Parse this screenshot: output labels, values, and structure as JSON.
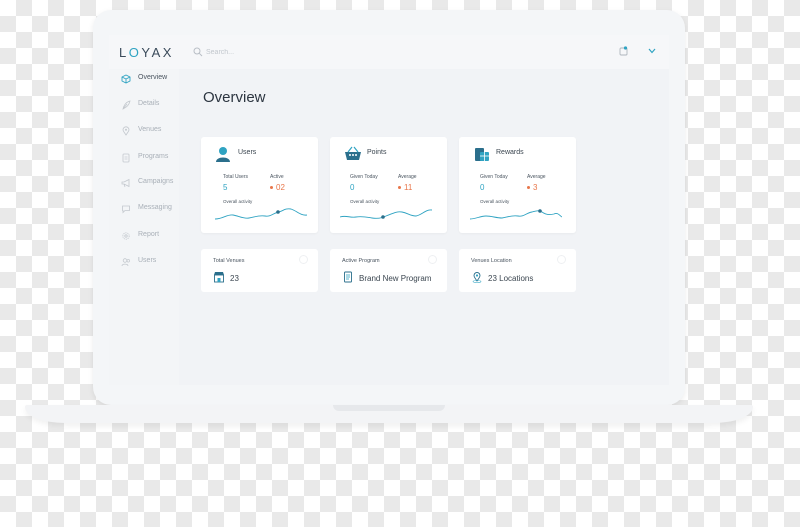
{
  "app": {
    "logo_prefix": "L",
    "logo_o": "O",
    "logo_suffix": "YAX"
  },
  "search": {
    "placeholder": "Search..."
  },
  "sidebar": {
    "items": [
      {
        "label": "Overview",
        "icon": "cube-icon"
      },
      {
        "label": "Details",
        "icon": "feather-icon"
      },
      {
        "label": "Venues",
        "icon": "map-pin-icon"
      },
      {
        "label": "Programs",
        "icon": "document-icon"
      },
      {
        "label": "Campaigns",
        "icon": "megaphone-icon"
      },
      {
        "label": "Messaging",
        "icon": "chat-icon"
      },
      {
        "label": "Report",
        "icon": "gear-icon"
      },
      {
        "label": "Users",
        "icon": "users-icon"
      }
    ]
  },
  "main": {
    "title": "Overview",
    "cards": [
      {
        "title": "Users",
        "icon": "user-icon",
        "stat1_label": "Total Users",
        "stat1_value": "5",
        "stat2_label": "Active",
        "stat2_value": "02",
        "activity_label": "Overall activity"
      },
      {
        "title": "Points",
        "icon": "basket-icon",
        "stat1_label": "Given Today",
        "stat1_value": "0",
        "stat2_label": "Average",
        "stat2_value": "11",
        "activity_label": "Overall activity"
      },
      {
        "title": "Rewards",
        "icon": "gift-icon",
        "stat1_label": "Given Today",
        "stat1_value": "0",
        "stat2_label": "Average",
        "stat2_value": "3",
        "activity_label": "Overall activity"
      }
    ],
    "mini_cards": [
      {
        "label": "Total Venues",
        "value": "23",
        "icon": "store-icon"
      },
      {
        "label": "Active Program",
        "value": "Brand New Program",
        "icon": "document-icon"
      },
      {
        "label": "Venues Location",
        "value": "23 Locations",
        "icon": "location-icon"
      }
    ]
  },
  "colors": {
    "accent": "#2fa3c2",
    "warn": "#e8764a",
    "text": "#2c3540"
  }
}
